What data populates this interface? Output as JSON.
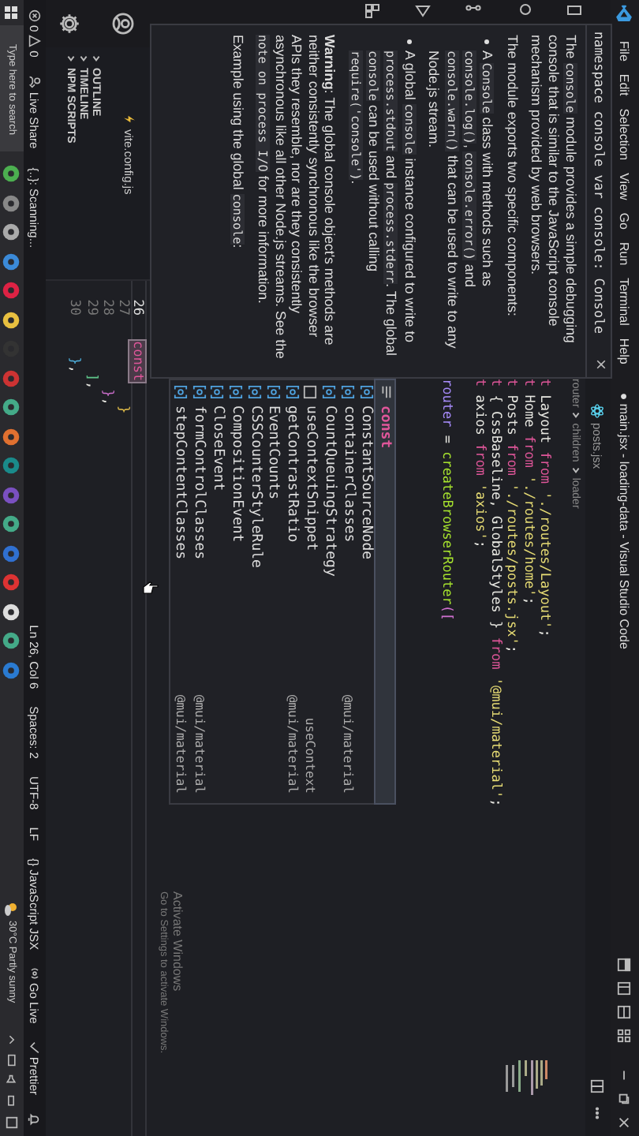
{
  "title_bar": {
    "menus": [
      "File",
      "Edit",
      "Selection",
      "View",
      "Go",
      "Run",
      "Terminal",
      "Help"
    ],
    "title": "● main.jsx - loading-data - Visual Studio Code"
  },
  "sidebar": {
    "files": [
      {
        "name": "vite.config.js"
      }
    ],
    "sections": [
      {
        "label": "OUTLINE",
        "expanded": false
      },
      {
        "label": "TIMELINE",
        "expanded": false
      },
      {
        "label": "NPM SCRIPTS",
        "expanded": false
      }
    ]
  },
  "editor": {
    "tab": {
      "label": "posts.jsx"
    },
    "breadcrumbs": [
      "router",
      "children",
      "loader"
    ],
    "top_lines": [
      {
        "kind": "code",
        "tokens": [
          {
            "text": "t",
            "kind": "keyword"
          },
          {
            "text": " Layout ",
            "kind": "plain"
          },
          {
            "text": "from",
            "kind": "keyword"
          },
          {
            "text": " './routes/Layout'",
            "kind": "string"
          },
          {
            "text": ";",
            "kind": "plain"
          }
        ]
      },
      {
        "kind": "code",
        "tokens": [
          {
            "text": "t",
            "kind": "keyword"
          },
          {
            "text": " Home ",
            "kind": "plain"
          },
          {
            "text": "from",
            "kind": "keyword"
          },
          {
            "text": " './routes/home'",
            "kind": "string"
          },
          {
            "text": ";",
            "kind": "plain"
          }
        ]
      },
      {
        "kind": "code",
        "tokens": [
          {
            "text": "t",
            "kind": "keyword"
          },
          {
            "text": " Posts ",
            "kind": "plain"
          },
          {
            "text": "from",
            "kind": "keyword"
          },
          {
            "text": " './routes/posts.jsx'",
            "kind": "string"
          },
          {
            "text": ";",
            "kind": "plain"
          }
        ]
      },
      {
        "kind": "code",
        "tokens": [
          {
            "text": "t",
            "kind": "keyword"
          },
          {
            "text": " { CssBaseline, GlobalStyles } ",
            "kind": "plain"
          },
          {
            "text": "from",
            "kind": "keyword"
          },
          {
            "text": " '@mui/material'",
            "kind": "string"
          },
          {
            "text": ";",
            "kind": "plain"
          }
        ]
      },
      {
        "kind": "code",
        "tokens": [
          {
            "text": "t",
            "kind": "keyword"
          },
          {
            "text": " axios ",
            "kind": "plain"
          },
          {
            "text": "from",
            "kind": "keyword"
          },
          {
            "text": " 'axios'",
            "kind": "string"
          },
          {
            "text": ";",
            "kind": "plain"
          }
        ]
      },
      {
        "kind": "blank"
      },
      {
        "kind": "code",
        "tokens": [
          {
            "text": "router",
            "kind": "variable"
          },
          {
            "text": " = ",
            "kind": "plain"
          },
          {
            "text": "createBrowserRouter",
            "kind": "function"
          },
          {
            "text": "([",
            "kind": "bracket2"
          }
        ]
      }
    ],
    "bottom_lines": [
      {
        "number": "26",
        "current": true,
        "tokens": [
          {
            "text": "const",
            "kind": "match"
          }
        ]
      },
      {
        "number": "27",
        "current": false,
        "tokens": [
          {
            "text": "        }",
            "kind": "bracket1"
          }
        ]
      },
      {
        "number": "28",
        "current": false,
        "tokens": [
          {
            "text": "      }",
            "kind": "bracket2"
          },
          {
            "text": ",",
            "kind": "plain"
          }
        ]
      },
      {
        "number": "29",
        "current": false,
        "tokens": [
          {
            "text": "    ]",
            "kind": "bracket3"
          },
          {
            "text": ",",
            "kind": "plain"
          }
        ]
      },
      {
        "number": "30",
        "current": false,
        "tokens": [
          {
            "text": "  }",
            "kind": "bracket4"
          },
          {
            "text": ",",
            "kind": "plain"
          }
        ]
      }
    ]
  },
  "hover": {
    "signature": "namespace console var console: Console",
    "doc": [
      {
        "kind": "para",
        "segments": [
          {
            "text": "The ",
            "kind": "text"
          },
          {
            "text": "console",
            "kind": "code"
          },
          {
            "text": " module provides a simple debugging console that is similar to the JavaScript console mechanism provided by web browsers.",
            "kind": "text"
          }
        ]
      },
      {
        "kind": "para",
        "segments": [
          {
            "text": "The module exports two specific components:",
            "kind": "text"
          }
        ]
      },
      {
        "kind": "bullet",
        "segments": [
          {
            "text": "A ",
            "kind": "text"
          },
          {
            "text": "Console",
            "kind": "code"
          },
          {
            "text": " class with methods such as ",
            "kind": "text"
          },
          {
            "text": "console.log()",
            "kind": "code"
          },
          {
            "text": ", ",
            "kind": "text"
          },
          {
            "text": "console.error()",
            "kind": "code"
          },
          {
            "text": " and ",
            "kind": "text"
          },
          {
            "text": "console.warn()",
            "kind": "code"
          },
          {
            "text": " that can be used to write to any Node.js stream.",
            "kind": "text"
          }
        ]
      },
      {
        "kind": "bullet",
        "segments": [
          {
            "text": "A global ",
            "kind": "text"
          },
          {
            "text": "console",
            "kind": "code"
          },
          {
            "text": " instance configured to write to ",
            "kind": "text"
          },
          {
            "text": "process.stdout",
            "kind": "code"
          },
          {
            "text": " and ",
            "kind": "text"
          },
          {
            "text": "process.stderr",
            "kind": "code"
          },
          {
            "text": ". The global ",
            "kind": "text"
          },
          {
            "text": "console",
            "kind": "code"
          },
          {
            "text": " can be used without calling ",
            "kind": "text"
          },
          {
            "text": "require('console')",
            "kind": "code"
          },
          {
            "text": ".",
            "kind": "text"
          }
        ]
      },
      {
        "kind": "para",
        "segments": [
          {
            "text": "Warning",
            "kind": "bold"
          },
          {
            "text": ": The global console object's methods are neither consistently synchronous like the browser APIs they resemble, nor are they consistently asynchronous like all other Node.js streams. See the ",
            "kind": "text"
          },
          {
            "text": "note on process I/O",
            "kind": "code"
          },
          {
            "text": " for more information.",
            "kind": "text"
          }
        ]
      },
      {
        "kind": "para",
        "segments": [
          {
            "text": "Example using the global ",
            "kind": "text"
          },
          {
            "text": "console",
            "kind": "code"
          },
          {
            "text": ":",
            "kind": "text"
          }
        ]
      }
    ]
  },
  "suggestions": [
    {
      "label": "const",
      "kind": "keyword",
      "selected": true
    },
    {
      "label": "ConstantSourceNode",
      "kind": "variable",
      "selected": false
    },
    {
      "label": "containerClasses",
      "kind": "variable",
      "detail": "@mui/material",
      "selected": false
    },
    {
      "label": "CountQueuingStrategy",
      "kind": "variable",
      "selected": false
    },
    {
      "label": "useContextSnippet",
      "kind": "snippet",
      "detail": "useContext",
      "selected": false
    },
    {
      "label": "getContrastRatio",
      "kind": "variable",
      "detail": "@mui/material",
      "selected": false
    },
    {
      "label": "EventCounts",
      "kind": "variable",
      "selected": false
    },
    {
      "label": "CSSCounterStyleRule",
      "kind": "variable",
      "selected": false
    },
    {
      "label": "CompositionEvent",
      "kind": "variable",
      "selected": false
    },
    {
      "label": "CloseEvent",
      "kind": "variable",
      "selected": false
    },
    {
      "label": "formControlClasses",
      "kind": "variable",
      "detail": "@mui/material",
      "selected": false
    },
    {
      "label": "stepContentClasses",
      "kind": "variable",
      "detail": "@mui/material",
      "selected": false
    }
  ],
  "os_notice": {
    "title": "Activate Windows",
    "text": "Go to Settings to activate Windows."
  },
  "status_bar": {
    "left": [
      {
        "kind": "problems",
        "errors": "0",
        "warnings": "0"
      },
      {
        "kind": "share",
        "text": "Live Share"
      },
      {
        "kind": "plain",
        "text": "{..}: Scanning..."
      }
    ],
    "right": [
      {
        "kind": "plain",
        "text": "Ln 26, Col 6"
      },
      {
        "kind": "plain",
        "text": "Spaces: 2"
      },
      {
        "kind": "plain",
        "text": "UTF-8"
      },
      {
        "kind": "plain",
        "text": "LF"
      },
      {
        "kind": "plain",
        "text": "{} JavaScript JSX"
      },
      {
        "kind": "broadcast",
        "text": "Go Live"
      },
      {
        "kind": "check",
        "text": "Prettier"
      },
      {
        "kind": "bell"
      }
    ]
  },
  "taskbar": {
    "search": {
      "placeholder": "Type here to search"
    },
    "weather": "30°C  Partly sunny"
  }
}
